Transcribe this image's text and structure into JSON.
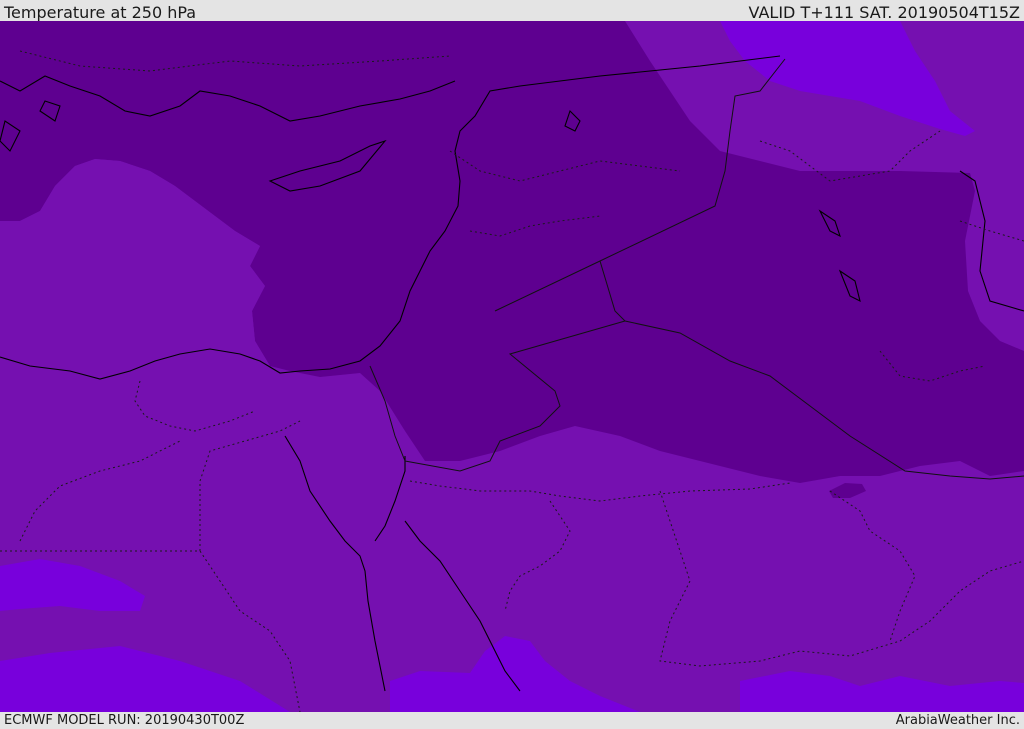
{
  "header": {
    "title": "Temperature at 250 hPa",
    "valid": "VALID T+111 SAT. 20190504T15Z"
  },
  "footer": {
    "model_run": "ECMWF MODEL RUN: 20190430T00Z",
    "brand": "ArabiaWeather Inc."
  },
  "map": {
    "field": "Temperature at 250 hPa",
    "colors": {
      "coldest": "#5e0090",
      "cold": "#7510b0",
      "cool": "#7800dc",
      "coastline": "#000000",
      "borders": "#1a1a1a"
    }
  }
}
